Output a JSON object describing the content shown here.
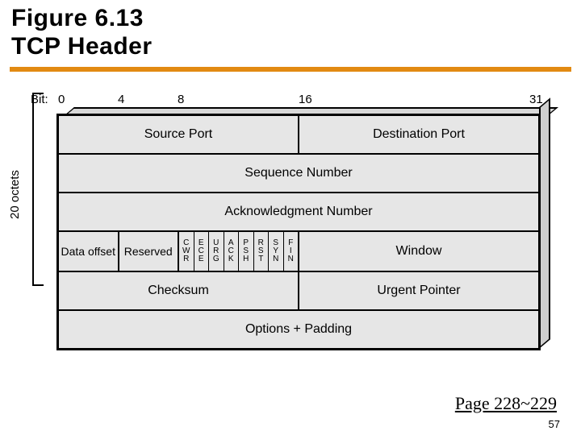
{
  "title_line1": "Figure 6.13",
  "title_line2": "TCP Header",
  "bit_label": "Bit:",
  "bit_ticks": {
    "t0": "0",
    "t4": "4",
    "t8": "8",
    "t16": "16",
    "t31": "31"
  },
  "octets_label": "20 octets",
  "rows": {
    "r1": {
      "source_port": "Source Port",
      "dest_port": "Destination Port"
    },
    "r2": {
      "seq": "Sequence Number"
    },
    "r3": {
      "ack": "Acknowledgment Number"
    },
    "r4": {
      "data_offset": "Data offset",
      "reserved": "Reserved",
      "flags": {
        "cwr": {
          "a": "C",
          "b": "W",
          "c": "R"
        },
        "ece": {
          "a": "E",
          "b": "C",
          "c": "E"
        },
        "urg": {
          "a": "U",
          "b": "R",
          "c": "G"
        },
        "ack": {
          "a": "A",
          "b": "C",
          "c": "K"
        },
        "psh": {
          "a": "P",
          "b": "S",
          "c": "H"
        },
        "rst": {
          "a": "R",
          "b": "S",
          "c": "T"
        },
        "syn": {
          "a": "S",
          "b": "Y",
          "c": "N"
        },
        "fin": {
          "a": "F",
          "b": "I",
          "c": "N"
        }
      },
      "window": "Window"
    },
    "r5": {
      "checksum": "Checksum",
      "urgent": "Urgent Pointer"
    },
    "r6": {
      "options": "Options + Padding"
    }
  },
  "page_ref": "Page 228~229",
  "slide_num": "57"
}
